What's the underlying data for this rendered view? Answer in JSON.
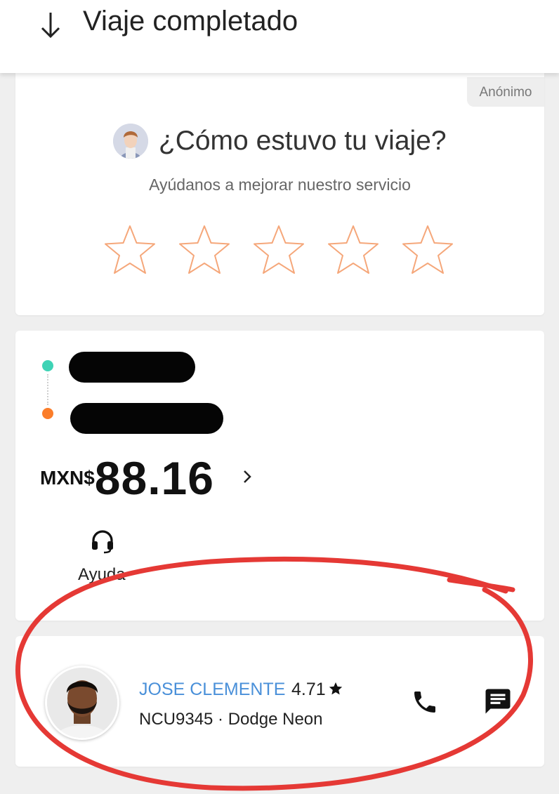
{
  "header": {
    "title": "Viaje completado",
    "back_icon": "arrow-down-icon"
  },
  "rating_card": {
    "anonymous_label": "Anónimo",
    "question": "¿Cómo estuvo tu viaje?",
    "subtitle": "Ayúdanos a mejorar nuestro servicio",
    "star_count": 5,
    "star_color": "#f5a77a"
  },
  "trip_card": {
    "pickup_color": "#3ed3b5",
    "dropoff_color": "#fb7d2a",
    "currency": "MXN$",
    "amount": "88.16",
    "help_label": "Ayuda"
  },
  "driver_card": {
    "name": "JOSE CLEMENTE",
    "rating": "4.71",
    "plate_model": "NCU9345 · Dodge Neon",
    "name_color": "#4a90d9"
  },
  "annotation": {
    "color": "#e53935",
    "shape": "freehand-circle"
  }
}
